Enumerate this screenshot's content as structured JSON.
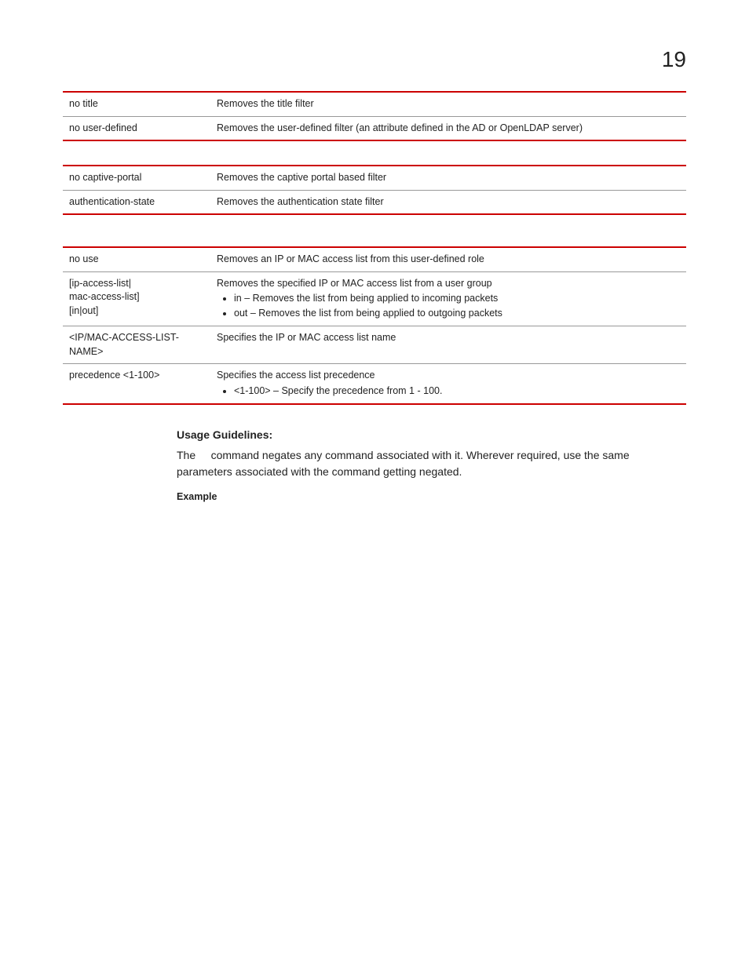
{
  "page_number": "19",
  "table1": {
    "rows": [
      {
        "c1": "no title",
        "c2": "Removes the title filter"
      },
      {
        "c1": "no user-defined",
        "c2": "Removes the user-defined filter (an attribute defined in the AD or OpenLDAP server)"
      }
    ]
  },
  "table2": {
    "rows": [
      {
        "c1": "no captive-portal",
        "c2": "Removes the captive portal based filter"
      },
      {
        "c1": "authentication-state",
        "c2": "Removes the authentication state filter"
      }
    ]
  },
  "table3": {
    "rows": [
      {
        "c1": "no use",
        "c2": "Removes an IP or MAC access list from this user-defined role"
      },
      {
        "c1_l1": "[ip-access-list|",
        "c1_l2": "mac-access-list]",
        "c1_l3": "[in|out]",
        "c2_intro": "Removes the specified IP or MAC access list from a user group",
        "c2_b1": "in – Removes the list from being applied to incoming packets",
        "c2_b2": "out – Removes the list from being applied to outgoing packets"
      },
      {
        "c1": "<IP/MAC-ACCESS-LIST-NAME>",
        "c2": "Specifies the IP or MAC access list name"
      },
      {
        "c1": "precedence <1-100>",
        "c2_intro": "Specifies the access list precedence",
        "c2_b1": "<1-100> – Specify the precedence from 1 - 100."
      }
    ]
  },
  "usage_heading": "Usage Guidelines:",
  "usage_body_pre": "The ",
  "usage_body_post": " command negates any command associated with it. Wherever required, use the same parameters associated with the command getting negated.",
  "example_label": "Example"
}
